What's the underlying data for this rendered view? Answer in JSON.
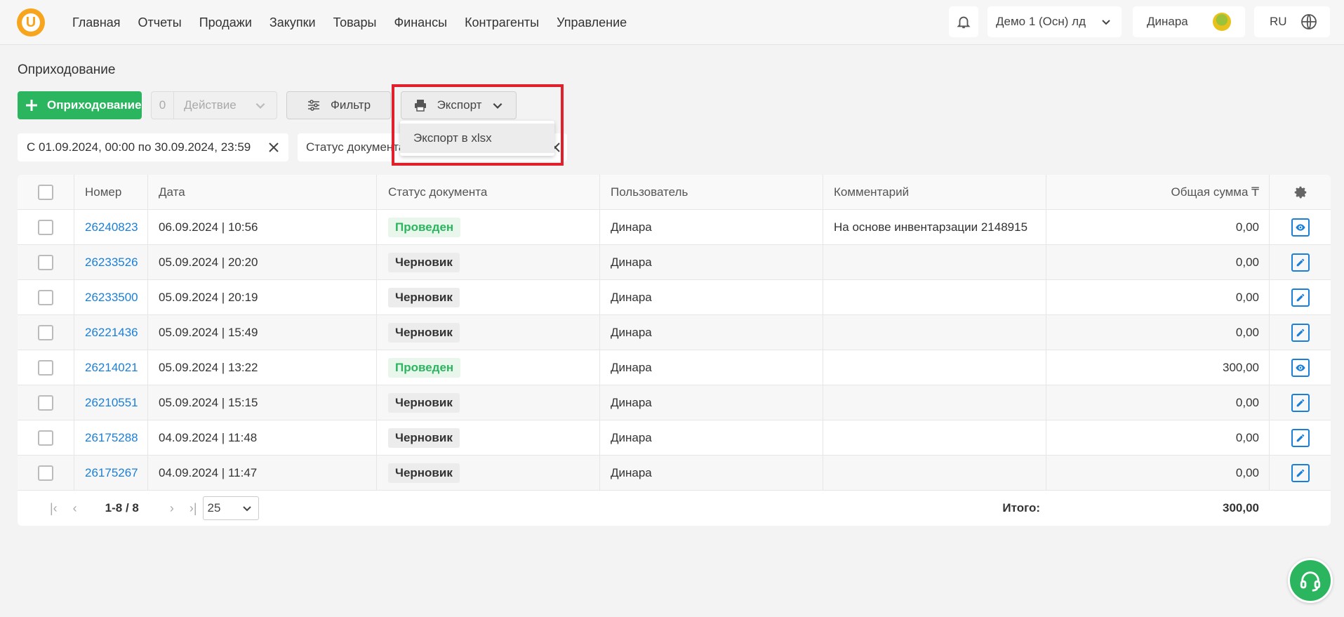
{
  "nav": {
    "logo": "U",
    "items": [
      "Главная",
      "Отчеты",
      "Продажи",
      "Закупки",
      "Товары",
      "Финансы",
      "Контрагенты",
      "Управление"
    ],
    "company": "Демо 1 (Осн) лд",
    "user": "Динара",
    "lang": "RU"
  },
  "page": {
    "title": "Оприходование"
  },
  "toolbar": {
    "add_label": "Оприходование",
    "action_count": "0",
    "action_label": "Действие",
    "filter_label": "Фильтр",
    "export_label": "Экспорт"
  },
  "export_menu": {
    "items": [
      "Экспорт в xlsx"
    ]
  },
  "filters": {
    "date": "С 01.09.2024, 00:00 по 30.09.2024, 23:59",
    "status": "Статус документа"
  },
  "table": {
    "columns": [
      "Номер",
      "Дата",
      "Статус документа",
      "Пользователь",
      "Комментарий",
      "Общая сумма ₸"
    ],
    "rows": [
      {
        "num": "26240823",
        "date": "06.09.2024 | 10:56",
        "status": "Проведен",
        "user": "Динара",
        "comment": "На основе инвентарзации 2148915",
        "sum": "0,00",
        "action": "view"
      },
      {
        "num": "26233526",
        "date": "05.09.2024 | 20:20",
        "status": "Черновик",
        "user": "Динара",
        "comment": "",
        "sum": "0,00",
        "action": "edit"
      },
      {
        "num": "26233500",
        "date": "05.09.2024 | 20:19",
        "status": "Черновик",
        "user": "Динара",
        "comment": "",
        "sum": "0,00",
        "action": "edit"
      },
      {
        "num": "26221436",
        "date": "05.09.2024 | 15:49",
        "status": "Черновик",
        "user": "Динара",
        "comment": "",
        "sum": "0,00",
        "action": "edit"
      },
      {
        "num": "26214021",
        "date": "05.09.2024 | 13:22",
        "status": "Проведен",
        "user": "Динара",
        "comment": "",
        "sum": "300,00",
        "action": "view"
      },
      {
        "num": "26210551",
        "date": "05.09.2024 | 15:15",
        "status": "Черновик",
        "user": "Динара",
        "comment": "",
        "sum": "0,00",
        "action": "edit"
      },
      {
        "num": "26175288",
        "date": "04.09.2024 | 11:48",
        "status": "Черновик",
        "user": "Динара",
        "comment": "",
        "sum": "0,00",
        "action": "edit"
      },
      {
        "num": "26175267",
        "date": "04.09.2024 | 11:47",
        "status": "Черновик",
        "user": "Динара",
        "comment": "",
        "sum": "0,00",
        "action": "edit"
      }
    ]
  },
  "footer": {
    "range": "1-8 / 8",
    "per_page": "25",
    "total_label": "Итого:",
    "total_value": "300,00"
  },
  "colors": {
    "green": "#2ab55e",
    "link": "#1a7fd8",
    "highlight": "#e0202a",
    "logo": "#f7a51c"
  }
}
